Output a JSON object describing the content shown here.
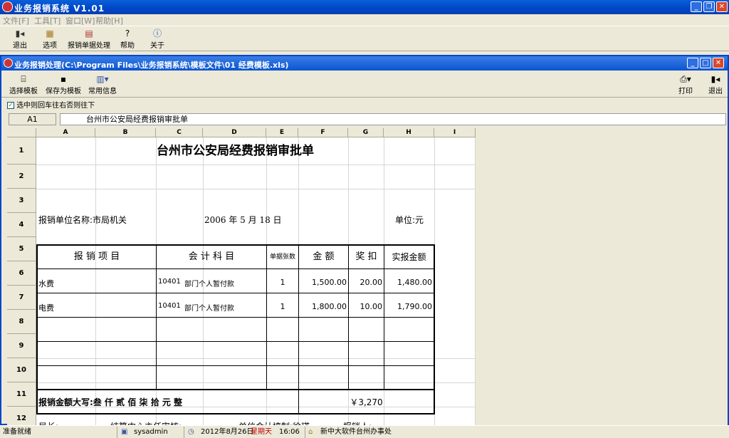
{
  "app": {
    "title": "业务报销系统  V1.01"
  },
  "menubar": [
    "文件[F]",
    "工具[T]",
    "窗口[W]",
    "帮助[H]"
  ],
  "toolbar": [
    {
      "label": "退出",
      "icon": "exit-icon"
    },
    {
      "label": "选项",
      "icon": "options-icon"
    },
    {
      "label": "报销单据处理",
      "icon": "document-icon"
    },
    {
      "label": "帮助",
      "icon": "help-icon"
    },
    {
      "label": "关于",
      "icon": "info-icon"
    }
  ],
  "inner": {
    "title": "业务报销处理(C:\\Program Files\\业务报销系统\\模板文件\\01 经费模板.xls)",
    "toolbar_left": [
      {
        "label": "选择模板",
        "icon": "template-icon"
      },
      {
        "label": "保存为模板",
        "icon": "save-icon"
      },
      {
        "label": "常用信息",
        "icon": "info-grid-icon"
      }
    ],
    "toolbar_right": [
      {
        "label": "打印",
        "icon": "printer-icon"
      },
      {
        "label": "退出",
        "icon": "exit-icon"
      }
    ],
    "checkbox_label": "选中则回车往右否则往下",
    "name_box": "A1",
    "formula": "台州市公安局经费报销审批单"
  },
  "sheet": {
    "columns": [
      "A",
      "B",
      "C",
      "D",
      "E",
      "F",
      "G",
      "H",
      "I"
    ],
    "rows": [
      "1",
      "2",
      "3",
      "4",
      "5",
      "6",
      "7",
      "8",
      "9",
      "10",
      "11",
      "12"
    ],
    "title": "台州市公安局经费报销审批单",
    "unit_name": "报销单位名称:市局机关",
    "date": "2006 年 5 月 18 日",
    "unit": "单位:元",
    "headers": {
      "item": "报 销 项 目",
      "account": "会 计 科 目",
      "count": "单据张数",
      "amount": "金  额",
      "deduct": "奖 扣",
      "actual": "实报金额"
    },
    "lines": [
      {
        "item": "水费",
        "code": "10401",
        "account": "部门个人暂付款",
        "count": "1",
        "amount": "1,500.00",
        "deduct": "20.00",
        "actual": "1,480.00"
      },
      {
        "item": "电费",
        "code": "10401",
        "account": "部门个人暂付款",
        "count": "1",
        "amount": "1,800.00",
        "deduct": "10.00",
        "actual": "1,790.00"
      }
    ],
    "total_caps": "报销金额大写:叁 仟 贰 佰 柒 拾 元 整",
    "total": "￥3,270",
    "sign": {
      "chief": "局长:",
      "center": "结算中心主任审核:",
      "accountant": "单位会计填制:徐瑛",
      "claimant": "报销人:"
    }
  },
  "status": {
    "ready": "准备就绪",
    "user": "sysadmin",
    "date": "2012年8月26日",
    "weekday": "星期天",
    "time": "16:06",
    "org": "新中大软件台州办事处"
  }
}
